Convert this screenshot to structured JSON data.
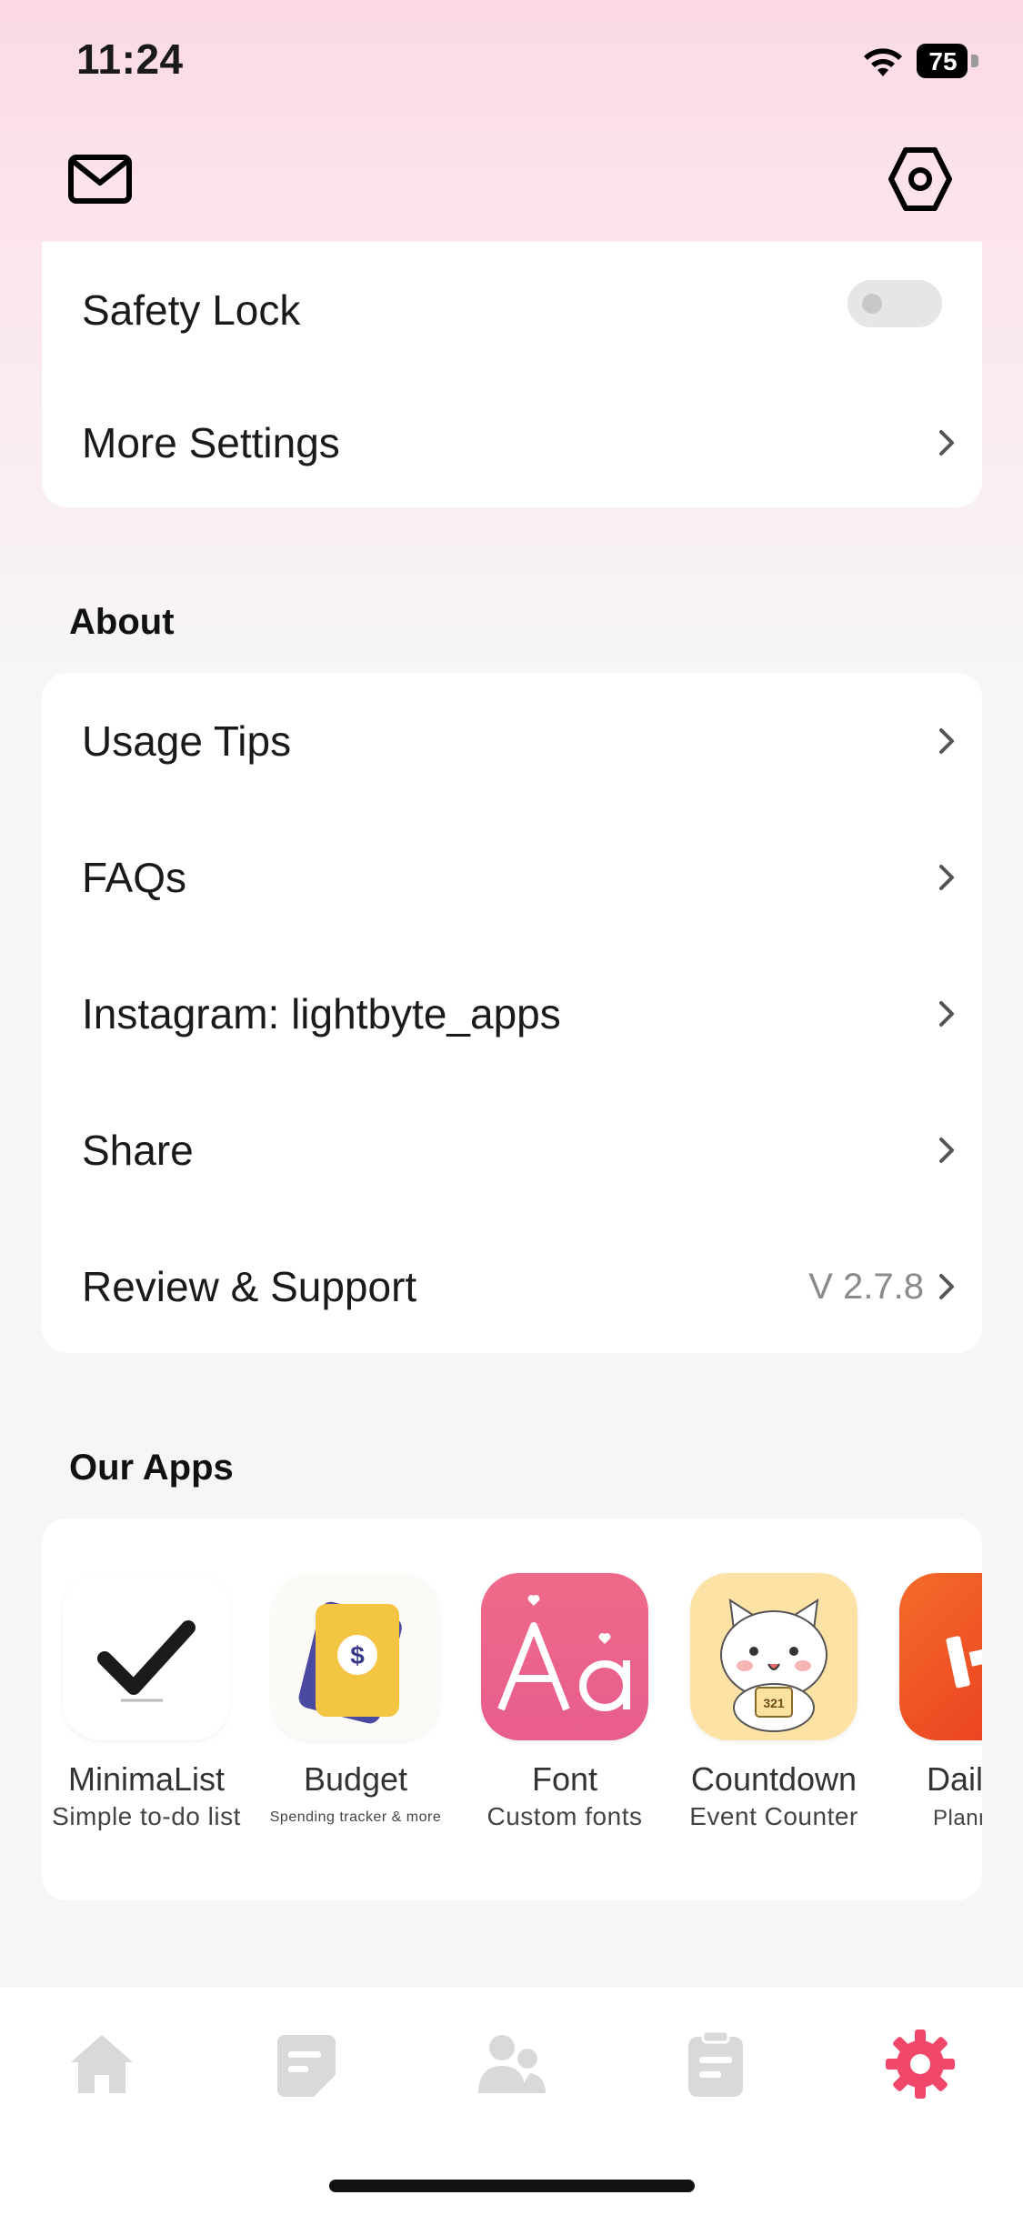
{
  "status_bar": {
    "time": "11:24",
    "battery": "75",
    "battery_level": 0.75
  },
  "settings_group": {
    "items": [
      {
        "label": "Safety Lock",
        "type": "toggle",
        "on": false
      },
      {
        "label": "More Settings",
        "type": "link"
      }
    ]
  },
  "about": {
    "title": "About",
    "items": [
      {
        "label": "Usage Tips"
      },
      {
        "label": "FAQs"
      },
      {
        "label": "Instagram: lightbyte_apps"
      },
      {
        "label": "Share"
      },
      {
        "label": "Review & Support",
        "value": "V 2.7.8"
      }
    ]
  },
  "our_apps": {
    "title": "Our Apps",
    "apps": [
      {
        "name": "MinimaList",
        "subtitle": "Simple to-do list",
        "icon": "checkmark-icon"
      },
      {
        "name": "Budget",
        "subtitle": "Spending tracker & more",
        "icon": "dollar-card-icon"
      },
      {
        "name": "Font",
        "subtitle": "Custom fonts",
        "icon": "font-aa-icon"
      },
      {
        "name": "Countdown",
        "subtitle": "Event Counter",
        "icon": "cat-calendar-icon"
      },
      {
        "name": "Daily W",
        "subtitle": "Planner &",
        "icon": "dumbbell-icon"
      }
    ]
  },
  "tab_bar": {
    "tabs": [
      {
        "icon": "home-icon",
        "active": false
      },
      {
        "icon": "notes-icon",
        "active": false
      },
      {
        "icon": "people-icon",
        "active": false
      },
      {
        "icon": "clipboard-icon",
        "active": false
      },
      {
        "icon": "settings-gear-icon",
        "active": true
      }
    ],
    "active_color": "#f0476b",
    "inactive_color": "#d9d9dc"
  }
}
